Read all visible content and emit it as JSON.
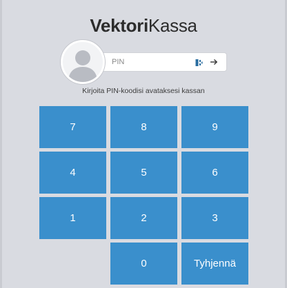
{
  "brand": {
    "bold": "Vektori",
    "regular": "Kassa"
  },
  "login": {
    "pin_placeholder": "PIN",
    "pin_value": "",
    "hint": "Kirjoita PIN-koodisi avataksesi kassan",
    "card_icon": "card-reader-icon",
    "submit_icon": "arrow-right-icon"
  },
  "keypad": {
    "rows": [
      [
        "7",
        "8",
        "9"
      ],
      [
        "4",
        "5",
        "6"
      ],
      [
        "1",
        "2",
        "3"
      ],
      [
        "",
        "0",
        "Tyhjennä"
      ]
    ],
    "key_color": "#3a8fcc",
    "key_text_color": "#ffffff"
  },
  "colors": {
    "background": "#d9dbe1",
    "accent": "#3a8fcc"
  }
}
